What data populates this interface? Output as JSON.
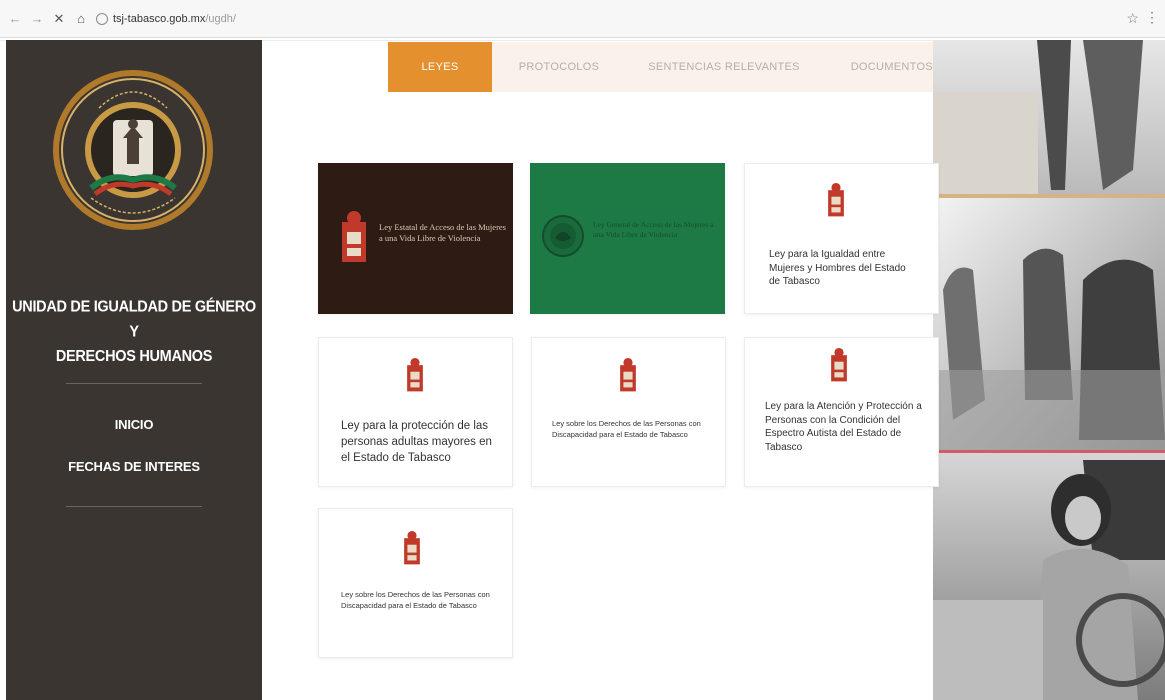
{
  "browser": {
    "url_host": "tsj-tabasco.gob.mx",
    "url_path": "/ugdh/",
    "back_glyph": "←",
    "forward_glyph": "→",
    "close_glyph": "✕",
    "home_glyph": "⌂",
    "star_glyph": "☆",
    "menu_glyph": "⋮"
  },
  "sidebar": {
    "unit_title_line1": "UNIDAD DE IGUALDAD DE GÉNERO Y",
    "unit_title_line2": "DERECHOS HUMANOS",
    "nav": [
      {
        "label": "INICIO"
      },
      {
        "label": "FECHAS DE INTERES"
      }
    ]
  },
  "tabs": [
    {
      "label": "LEYES",
      "active": true
    },
    {
      "label": "PROTOCOLOS",
      "active": false
    },
    {
      "label": "SENTENCIAS RELEVANTES",
      "active": false
    },
    {
      "label": "DOCUMENTOS DE INTERES",
      "active": false
    }
  ],
  "cards": [
    {
      "style": "dark",
      "text": "Ley Estatal de Acceso de las Mujeres a una Vida Libre de Violencia",
      "icon": "state-emblem-icon"
    },
    {
      "style": "green",
      "text": "Ley General de Acceso de las Mujeres a una Vida Libre de Violencia",
      "icon": "mexico-seal-icon"
    },
    {
      "style": "light",
      "text": "Ley para la Igualdad entre Mujeres y Hombres del Estado de Tabasco",
      "icon": "state-emblem-icon"
    },
    {
      "style": "light",
      "text": "Ley para la protección de las personas adultas mayores en el Estado de Tabasco",
      "icon": "state-emblem-icon"
    },
    {
      "style": "light",
      "text": "Ley sobre los Derechos de las Personas con Discapacidad para el Estado de Tabasco",
      "icon": "state-emblem-icon"
    },
    {
      "style": "light",
      "text": "Ley para la Atención y Protección a Personas con la Condición del Espectro Autista del Estado de Tabasco",
      "icon": "state-emblem-icon"
    },
    {
      "style": "light",
      "text": "Ley sobre los Derechos de las Personas con Discapacidad para el Estado de Tabasco",
      "icon": "state-emblem-icon"
    }
  ],
  "colors": {
    "sidebar": "#3a3530",
    "accent": "#e4902f",
    "tab_inactive": "#f9f1ea",
    "card_dark": "#2e1b13",
    "card_green": "#1d7a45",
    "emblem_red": "#c0392b"
  }
}
